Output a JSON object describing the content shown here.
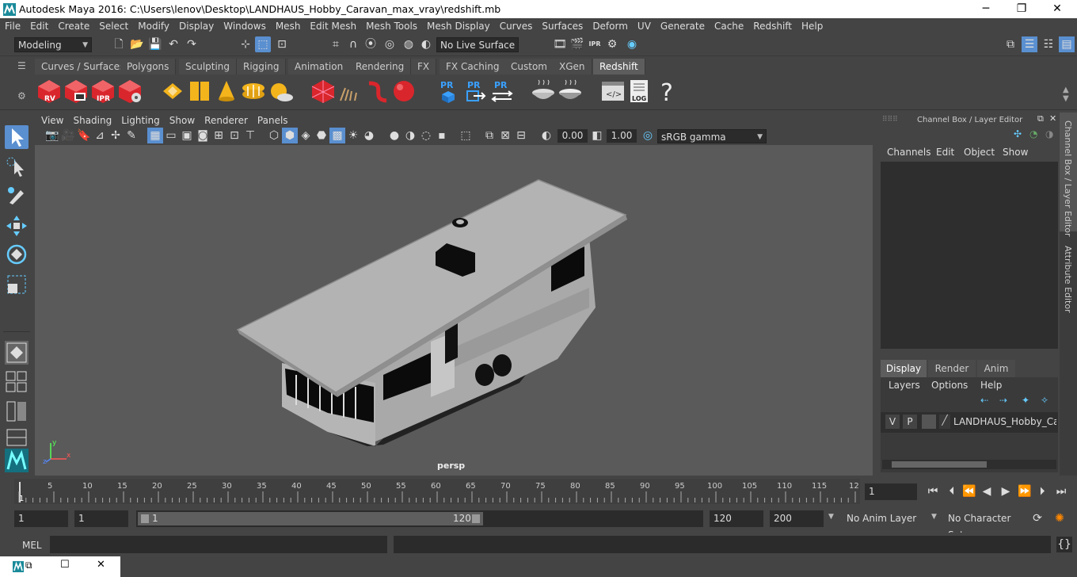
{
  "window": {
    "title": "Autodesk Maya 2016: C:\\Users\\lenov\\Desktop\\LANDHAUS_Hobby_Caravan_max_vray\\redshift.mb",
    "minimize": "─",
    "maximize": "❐",
    "close": "✕"
  },
  "menu": [
    "File",
    "Edit",
    "Create",
    "Select",
    "Modify",
    "Display",
    "Windows",
    "Mesh",
    "Edit Mesh",
    "Mesh Tools",
    "Mesh Display",
    "Curves",
    "Surfaces",
    "Deform",
    "UV",
    "Generate",
    "Cache",
    "Redshift",
    "Help"
  ],
  "status": {
    "mode": "Modeling",
    "live_surface": "No Live Surface"
  },
  "shelf_tabs": [
    "Curves / Surfaces",
    "Polygons",
    "Sculpting",
    "Rigging",
    "Animation",
    "Rendering",
    "FX",
    "FX Caching",
    "Custom",
    "XGen",
    "Redshift"
  ],
  "shelf_active": "Redshift",
  "shelf_icons": {
    "rv": "RV",
    "ipr": "IPR",
    "pr": "PR",
    "log": "LOG",
    "help": "?"
  },
  "viewport": {
    "menu": [
      "View",
      "Shading",
      "Lighting",
      "Show",
      "Renderer",
      "Panels"
    ],
    "exposure": "0.00",
    "gamma": "1.00",
    "colorspace": "sRGB gamma",
    "camera": "persp",
    "axis_y": "y",
    "axis_x": "x",
    "axis_z": "z"
  },
  "channel_box": {
    "title": "Channel Box / Layer Editor",
    "menu": [
      "Channels",
      "Edit",
      "Object",
      "Show"
    ]
  },
  "layer_editor": {
    "tabs": [
      "Display",
      "Render",
      "Anim"
    ],
    "active_tab": "Display",
    "menu": [
      "Layers",
      "Options",
      "Help"
    ],
    "layer": {
      "v": "V",
      "p": "P",
      "name": "LANDHAUS_Hobby_Cara"
    }
  },
  "side_tabs": [
    "Channel Box / Layer Editor",
    "Attribute Editor"
  ],
  "timeline": {
    "ticks": [
      "5",
      "10",
      "15",
      "20",
      "25",
      "30",
      "35",
      "40",
      "45",
      "50",
      "55",
      "60",
      "65",
      "70",
      "75",
      "80",
      "85",
      "90",
      "95",
      "100",
      "105",
      "110",
      "115",
      "12"
    ],
    "start_marker": "1",
    "current_frame": "1"
  },
  "range": {
    "start": "1",
    "playback_start": "1",
    "slider_start": "1",
    "slider_end": "120",
    "playback_end": "120",
    "end": "200",
    "anim_layer": "No Anim Layer",
    "character_set": "No Character Set"
  },
  "cmdline": {
    "label": "MEL"
  },
  "colors": {
    "accent_tab": "#5d5d5d",
    "viewport_bg": "#5a5a5a",
    "redshift_red": "#d9262c",
    "select_blue": "#5a8fd0"
  }
}
